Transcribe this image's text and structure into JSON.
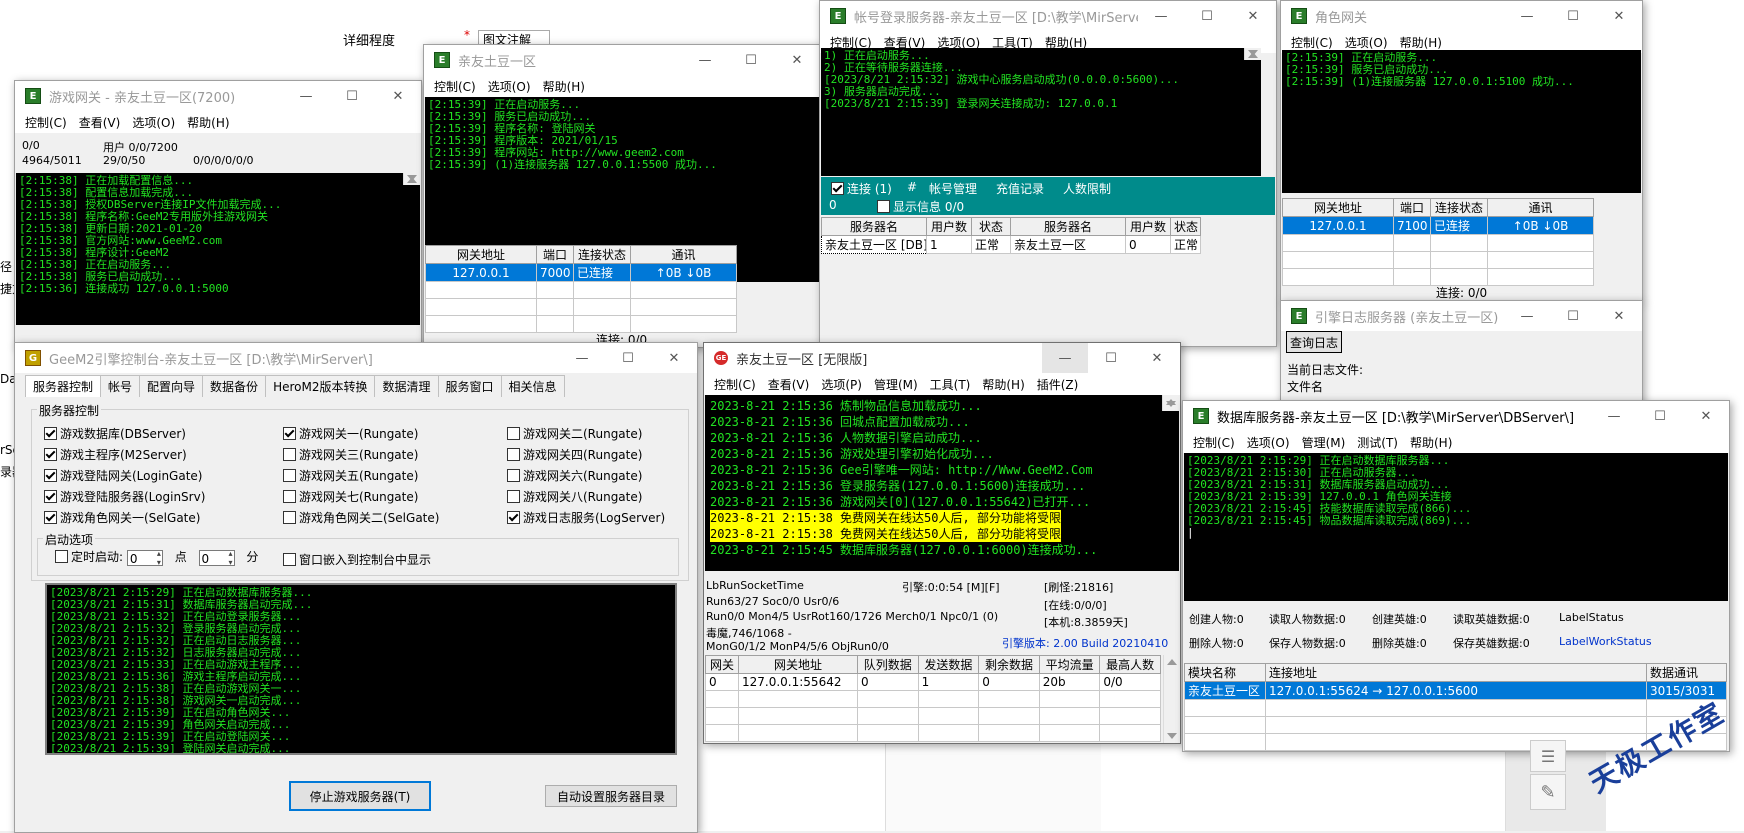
{
  "background": {
    "detail_label": "详细程度",
    "detail_value": "图文注解",
    "left_edge_text": [
      "径",
      "捷方",
      "Dat",
      "rSe",
      "录器"
    ]
  },
  "gamegate": {
    "title": "游戏网关 - 亲友土豆一区(7200)",
    "menu": [
      "控制(C)",
      "查看(V)",
      "选项(O)",
      "帮助(H)"
    ],
    "stat1": "0/0",
    "stat2": "用户 0/0/7200",
    "stat3": "4964/5011",
    "stat4": "29/0/50",
    "stat5": "0/0/0/0/0/0",
    "logs": [
      "[2:15:38] 正在加载配置信息...",
      "[2:15:38] 配置信息加载完成...",
      "[2:15:38] 授权DBServer连接IP文件加载完成...",
      "[2:15:38] 程序名称:GeeM2专用版外挂游戏网关",
      "[2:15:38] 更新日期:2021-01-20",
      "[2:15:38] 官方网站:www.GeeM2.com",
      "[2:15:38] 程序设计:GeeM2",
      "[2:15:38] 正在启动服务...",
      "[2:15:38] 服务已启动成功...",
      "[2:15:36] 连接成功 127.0.0.1:5000"
    ]
  },
  "logingate": {
    "title": "亲友土豆一区",
    "menu": [
      "控制(C)",
      "选项(O)",
      "帮助(H)"
    ],
    "logs": [
      "[2:15:39] 正在启动服务...",
      "[2:15:39] 服务已启动成功...",
      "[2:15:39] 程序名称: 登陆网关",
      "[2:15:39] 程序版本: 2021/01/15",
      "[2:15:39] 程序网站: http://www.geem2.com",
      "[2:15:39] (1)连接服务器 127.0.0.1:5500 成功..."
    ],
    "headers": [
      "网关地址",
      "端口",
      "连接状态",
      "通讯"
    ],
    "row": [
      "127.0.0.1",
      "7000",
      "已连接",
      "↑0B ↓0B"
    ],
    "status": "连接: 0/0"
  },
  "loginsrv": {
    "title": "帐号登录服务器-亲友土豆一区  [D:\\教学\\MirServer\\...",
    "menu": [
      "控制(C)",
      "查看(V)",
      "选项(O)",
      "工具(T)",
      "帮助(H)"
    ],
    "logs": [
      "1) 正在启动服务...",
      "2) 正在等待服务器连接...",
      "[2023/8/21 2:15:32] 游戏中心服务启动成功(0.0.0.0:5600)...",
      "3) 服务器启动完成...",
      "[2023/8/21 2:15:39] 登录网关连接成功: 127.0.0.1"
    ],
    "bar_items": [
      "连接 (1)",
      "#",
      "帐号管理",
      "充值记录",
      "人数限制"
    ],
    "count": "0",
    "show_info": "显示信息",
    "show_info_val": "0/0",
    "headers": [
      "服务器名",
      "用户数",
      "状态",
      "服务器名",
      "用户数",
      "状态"
    ],
    "row": [
      "亲友土豆一区 [DB]",
      "1",
      "正常",
      "亲友土豆一区",
      "0",
      "正常"
    ]
  },
  "selgate": {
    "title": "角色网关",
    "menu": [
      "控制(C)",
      "选项(O)",
      "帮助(H)"
    ],
    "logs": [
      "[2:15:39] 正在启动服务...",
      "[2:15:39] 服务已启动成功...",
      "[2:15:39] (1)连接服务器 127.0.0.1:5100 成功..."
    ],
    "headers": [
      "网关地址",
      "端口",
      "连接状态",
      "通讯"
    ],
    "row": [
      "127.0.0.1",
      "7100",
      "已连接",
      "↑0B ↓0B"
    ],
    "status": "连接: 0/0"
  },
  "logserver": {
    "title": "引擎日志服务器 (亲友土豆一区)",
    "button": "查询日志",
    "label1": "当前日志文件:",
    "label2": "文件名"
  },
  "control": {
    "title": "GeeM2引擎控制台-亲友土豆一区 [D:\\教学\\MirServer\\]",
    "tabs": [
      "服务器控制",
      "帐号",
      "配置向导",
      "数据备份",
      "HeroM2版本转换",
      "数据清理",
      "服务窗口",
      "相关信息"
    ],
    "group_title": "服务器控制",
    "checks": [
      {
        "label": "游戏数据库(DBServer)",
        "on": true
      },
      {
        "label": "游戏网关一(Rungate)",
        "on": true
      },
      {
        "label": "游戏网关二(Rungate)",
        "on": false
      },
      {
        "label": "游戏主程序(M2Server)",
        "on": true
      },
      {
        "label": "游戏网关三(Rungate)",
        "on": false
      },
      {
        "label": "游戏网关四(Rungate)",
        "on": false
      },
      {
        "label": "游戏登陆网关(LoginGate)",
        "on": true
      },
      {
        "label": "游戏网关五(Rungate)",
        "on": false
      },
      {
        "label": "游戏网关六(Rungate)",
        "on": false
      },
      {
        "label": "游戏登陆服务器(LoginSrv)",
        "on": true
      },
      {
        "label": "游戏网关七(Rungate)",
        "on": false
      },
      {
        "label": "游戏网关八(Rungate)",
        "on": false
      },
      {
        "label": "游戏角色网关一(SelGate)",
        "on": true
      },
      {
        "label": "游戏角色网关二(SelGate)",
        "on": false
      },
      {
        "label": "游戏日志服务(LogServer)",
        "on": true
      }
    ],
    "start_group": "启动选项",
    "timed_start": "定时启动:",
    "hour": "0",
    "point": "点",
    "minute": "0",
    "minute_label": "分",
    "embed": "窗口嵌入到控制台中显示",
    "logs": [
      "[2023/8/21 2:15:29] 正在启动数据库服务器...",
      "[2023/8/21 2:15:31] 数据库服务器启动完成...",
      "[2023/8/21 2:15:32] 正在启动登录服务器...",
      "[2023/8/21 2:15:32] 登录服务器启动完成...",
      "[2023/8/21 2:15:32] 正在启动日志服务器...",
      "[2023/8/21 2:15:32] 日志服务器启动完成...",
      "[2023/8/21 2:15:33] 正在启动游戏主程序...",
      "[2023/8/21 2:15:36] 游戏主程序启动完成...",
      "[2023/8/21 2:15:38] 正在启动游戏网关一...",
      "[2023/8/21 2:15:38] 游戏网关一启动完成...",
      "[2023/8/21 2:15:39] 正在启动角色网关...",
      "[2023/8/21 2:15:39] 角色网关启动完成...",
      "[2023/8/21 2:15:39] 正在启动登陆网关...",
      "[2023/8/21 2:15:39] 登陆网关启动完成..."
    ],
    "stop_button": "停止游戏服务器(T)",
    "auto_button": "自动设置服务器目录"
  },
  "m2": {
    "title": "亲友土豆一区 [无限版]",
    "menu": [
      "控制(C)",
      "查看(V)",
      "选项(P)",
      "管理(M)",
      "工具(T)",
      "帮助(H)",
      "插件(Z)"
    ],
    "logs": [
      {
        "t": "2023-8-21 2:15:36 炼制物品信息加载成功...",
        "hl": false
      },
      {
        "t": "2023-8-21 2:15:36 回城点配置加载成功...",
        "hl": false
      },
      {
        "t": "2023-8-21 2:15:36 人物数据引擎启动成功...",
        "hl": false
      },
      {
        "t": "2023-8-21 2:15:36 游戏处理引擎初始化成功...",
        "hl": false
      },
      {
        "t": "2023-8-21 2:15:36 Gee引擎唯一网站: http://Www.GeeM2.Com",
        "hl": false
      },
      {
        "t": "2023-8-21 2:15:36 登录服务器(127.0.0.1:5600)连接成功...",
        "hl": false
      },
      {
        "t": "2023-8-21 2:15:36 游戏网关[0](127.0.0.1:55642)已打开...",
        "hl": false
      },
      {
        "t": "2023-8-21 2:15:38 免费网关在线达50人后, 部分功能将受限",
        "hl": true
      },
      {
        "t": "2023-8-21 2:15:38 免费网关在线达50人后, 部分功能将受限",
        "hl": true
      },
      {
        "t": "2023-8-21 2:15:45 数据库服务器(127.0.0.1:6000)连接成功...",
        "hl": false
      }
    ],
    "info": {
      "l1a": "LbRunSocketTime",
      "l1b": "引擎:0:0:54 [M][F]",
      "l1c": "[刷怪:21816]",
      "l2a": "Run63/27 Soc0/0 Usr0/6",
      "l2c": "[在线:0/0/0]",
      "l3a": "Run0/0 Mon4/5 UsrRot160/1726 Merch0/1 Npc0/1 (0)",
      "l3c": "[本机:8.3859天]",
      "l4a": "毒魔,746/1068 -",
      "l5a": "MonG0/1/2 MonP4/5/6 ObjRun0/0",
      "l5c": "引擎版本: 2.00 Build 20210410"
    },
    "headers": [
      "网关",
      "网关地址",
      "队列数据",
      "发送数据",
      "剩余数据",
      "平均流量",
      "最高人数"
    ],
    "row": [
      "0",
      "127.0.0.1:55642",
      "0",
      "1",
      "0",
      "20b",
      "0/0"
    ]
  },
  "dbserver": {
    "title": "数据库服务器-亲友土豆一区  [D:\\教学\\MirServer\\DBServer\\]",
    "menu": [
      "控制(C)",
      "选项(O)",
      "管理(M)",
      "测试(T)",
      "帮助(H)"
    ],
    "logs": [
      "[2023/8/21 2:15:29] 正在启动数据库服务器...",
      "[2023/8/21 2:15:30] 正在启动服务器...",
      "[2023/8/21 2:15:31] 数据库服务器启动成功...",
      "[2023/8/21 2:15:39] 127.0.0.1 角色网关连接",
      "[2023/8/21 2:15:45] 技能数据库读取完成(866)...",
      "[2023/8/21 2:15:45] 物品数据库读取完成(869)..."
    ],
    "stats": [
      [
        "创建人物:0",
        "读取人物数据:0",
        "创建英雄:0",
        "读取英雄数据:0",
        "LabelStatus"
      ],
      [
        "删除人物:0",
        "保存人物数据:0",
        "删除英雄:0",
        "保存英雄数据:0",
        "LabelWorkStatus"
      ]
    ],
    "headers": [
      "模块名称",
      "连接地址",
      "数据通讯"
    ],
    "row": [
      "亲友土豆一区",
      "127.0.0.1:55624 → 127.0.0.1:5600",
      "3015/3031"
    ]
  },
  "watermark": "天极工作室",
  "colors": {
    "console_bg": "#000000",
    "console_text": "#22e322",
    "selection": "#0078d7",
    "teal_bar": "#008b8b",
    "highlight": "#ffff00"
  }
}
